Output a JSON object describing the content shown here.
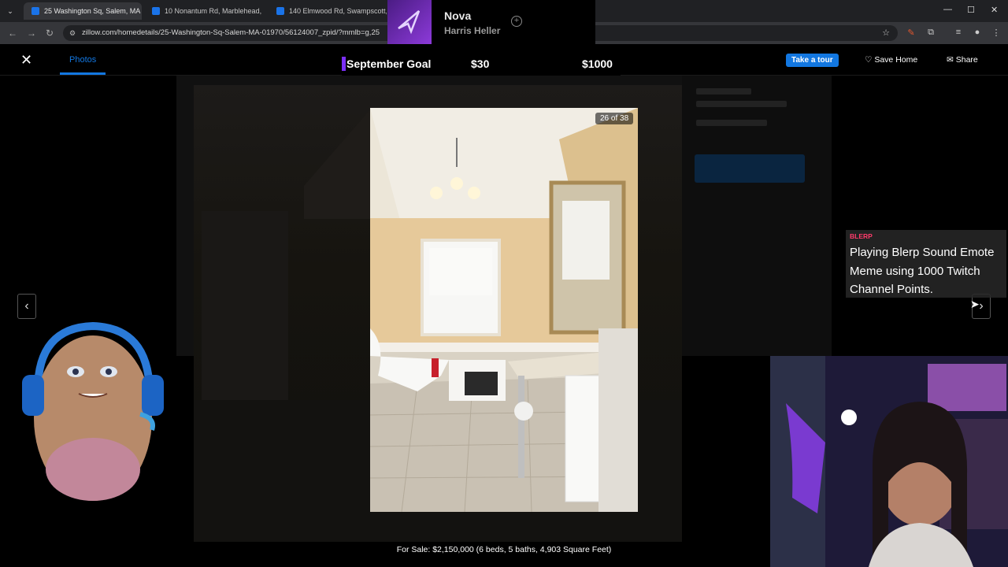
{
  "browser": {
    "tabs": [
      {
        "title": "25 Washington Sq, Salem, MA 0",
        "active": true
      },
      {
        "title": "10 Nonantum Rd, Marblehead,",
        "active": false
      },
      {
        "title": "140 Elmwood Rd, Swampscott,",
        "active": false
      }
    ],
    "tab_close": "✕",
    "url": "zillow.com/homedetails/25-Washington-Sq-Salem-MA-01970/56124007_zpid/?mmlb=g,25"
  },
  "viewer": {
    "close_label": "✕",
    "photos_tab": "Photos",
    "take_tour": "Take a tour",
    "save_home": "Save Home",
    "share": "Share",
    "counter": "26 of 38",
    "prev_arrow": "‹",
    "next_arrow": "›",
    "caption": "For Sale: $2,150,000 (6 beds, 5 baths, 4,903 Square Feet)"
  },
  "stream": {
    "alert": {
      "name": "Nova",
      "sub": "Harris Heller",
      "add": "+"
    },
    "goal": {
      "title": "September Goal",
      "current": "$30",
      "target": "$1000"
    },
    "blerp": {
      "tag": "BLERP",
      "message": "Playing Blerp Sound Emote Meme using 1000 Twitch Channel Points."
    }
  },
  "colors": {
    "zillow_blue": "#1277e1",
    "goal_accent": "#7b2ff7",
    "blerp_tag": "#ff3b6b"
  }
}
